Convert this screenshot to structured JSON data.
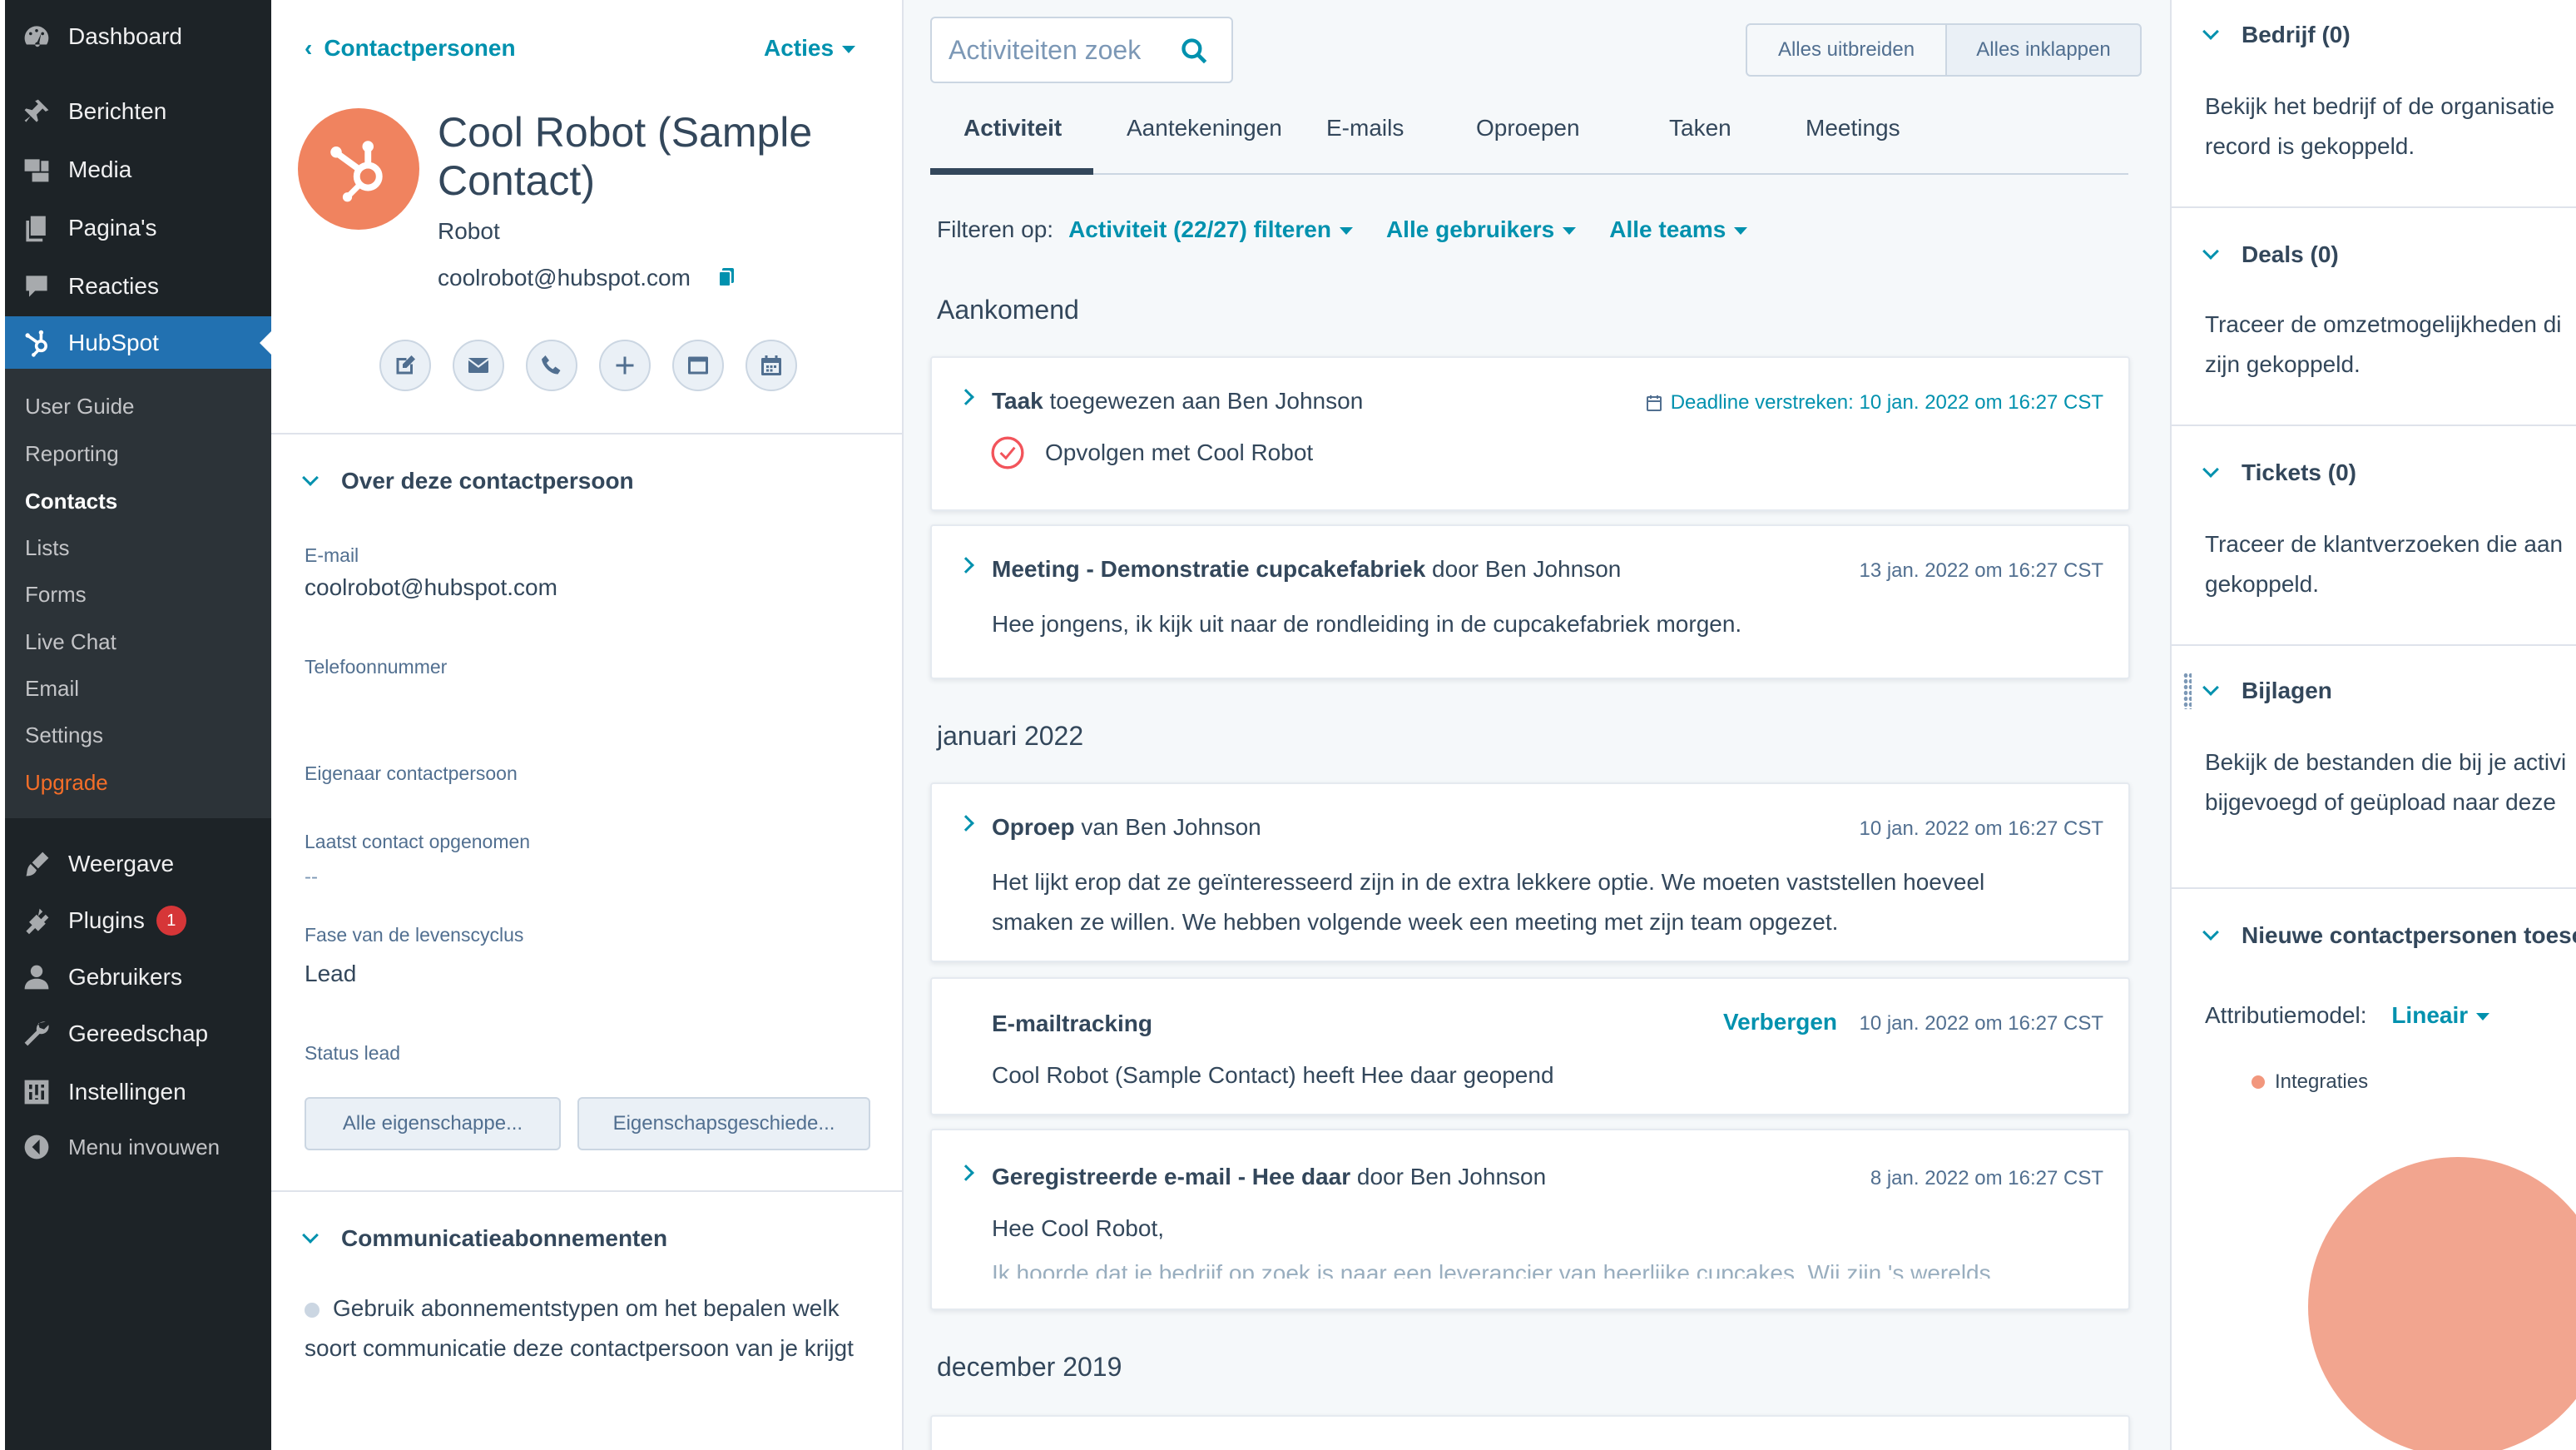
{
  "wp_menu": {
    "top": [
      {
        "label": "Dashboard",
        "icon": "dashboard-icon"
      },
      {
        "label": "Berichten",
        "icon": "pin-icon"
      },
      {
        "label": "Media",
        "icon": "media-icon"
      },
      {
        "label": "Pagina's",
        "icon": "pages-icon"
      },
      {
        "label": "Reacties",
        "icon": "comments-icon"
      },
      {
        "label": "HubSpot",
        "icon": "hubspot-icon"
      }
    ],
    "submenu": [
      "User Guide",
      "Reporting",
      "Contacts",
      "Lists",
      "Forms",
      "Live Chat",
      "Email",
      "Settings",
      "Upgrade"
    ],
    "bottom": [
      {
        "label": "Weergave",
        "icon": "brush-icon"
      },
      {
        "label": "Plugins",
        "icon": "plugin-icon",
        "badge": "1"
      },
      {
        "label": "Gebruikers",
        "icon": "users-icon"
      },
      {
        "label": "Gereedschap",
        "icon": "wrench-icon"
      },
      {
        "label": "Instellingen",
        "icon": "settings-icon"
      },
      {
        "label": "Menu invouwen",
        "icon": "collapse-icon"
      }
    ]
  },
  "contact": {
    "back_label": "Contactpersonen",
    "actions_label": "Acties",
    "name": "Cool Robot (Sample Contact)",
    "role": "Robot",
    "email": "coolrobot@hubspot.com",
    "about_title": "Over deze contactpersoon",
    "properties": [
      {
        "label": "E-mail",
        "value": "coolrobot@hubspot.com"
      },
      {
        "label": "Telefoonnummer",
        "value": ""
      },
      {
        "label": "Eigenaar contactpersoon",
        "value": ""
      },
      {
        "label": "Laatst contact opgenomen",
        "value": "--"
      },
      {
        "label": "Fase van de levenscyclus",
        "value": "Lead"
      },
      {
        "label": "Status lead",
        "value": ""
      }
    ],
    "all_props_button": "Alle eigenschappe...",
    "history_button": "Eigenschapsgeschiede...",
    "comm_title": "Communicatieabonnementen",
    "comm_text": "Gebruik abonnementstypen om het bepalen welk soort communicatie deze contactpersoon van je krijgt"
  },
  "timeline": {
    "search_placeholder": "Activiteiten zoek",
    "expand_all": "Alles uitbreiden",
    "collapse_all": "Alles inklappen",
    "tabs": [
      "Activiteit",
      "Aantekeningen",
      "E-mails",
      "Oproepen",
      "Taken",
      "Meetings"
    ],
    "filter_label": "Filteren op:",
    "filters": [
      "Activiteit (22/27) filteren",
      "Alle gebruikers",
      "Alle teams"
    ],
    "upcoming_header": "Aankomend",
    "task": {
      "type": "Taak",
      "rest": " toegewezen aan Ben Johnson",
      "deadline": "Deadline verstreken: 10 jan. 2022 om 16:27 CST",
      "subject": "Opvolgen met Cool Robot"
    },
    "meeting": {
      "type": "Meeting - Demonstratie cupcakefabriek",
      "rest": " door Ben Johnson",
      "timestamp": "13 jan. 2022 om 16:27 CST",
      "body": "Hee jongens, ik kijk uit naar de rondleiding in de cupcakefabriek morgen."
    },
    "month_header": "januari 2022",
    "call": {
      "type": "Oproep",
      "rest": " van Ben Johnson",
      "timestamp": "10 jan. 2022 om 16:27 CST",
      "body": "Het lijkt erop dat ze geïnteresseerd zijn in de extra lekkere optie. We moeten vaststellen hoeveel smaken ze willen. We hebben volgende week een meeting met zijn team opgezet."
    },
    "tracking": {
      "title": "E-mailtracking",
      "hide_label": "Verbergen",
      "timestamp": "10 jan. 2022 om 16:27 CST",
      "body": "Cool Robot (Sample Contact) heeft Hee daar geopend"
    },
    "logged_email": {
      "type": "Geregistreerde e-mail - Hee daar",
      "rest": " door Ben Johnson",
      "timestamp": "8 jan. 2022 om 16:27 CST",
      "line1": "Hee Cool Robot,",
      "line2": "Ik hoorde dat je bedrijf op zoek is naar een leverancier van heerlijke cupcakes. Wij zijn 's werelds"
    },
    "month_header_2": "december 2019"
  },
  "sidebar_right": {
    "company_title": "Bedrijf (0)",
    "company_text_1": "Bekijk het bedrijf of de organisatie",
    "company_text_2": "record is gekoppeld.",
    "deals_title": "Deals (0)",
    "deals_text_1": "Traceer de omzetmogelijkheden di",
    "deals_text_2": "zijn gekoppeld.",
    "tickets_title": "Tickets (0)",
    "tickets_text_1": "Traceer de klantverzoeken die aan",
    "tickets_text_2": "gekoppeld.",
    "attachments_title": "Bijlagen",
    "attachments_text_1": "Bekijk de bestanden die bij je activi",
    "attachments_text_2": "bijgevoegd of geüpload naar deze",
    "new_contacts_title": "Nieuwe contactpersonen toesc",
    "attribution_label": "Attributiemodel:",
    "attribution_value": "Lineair",
    "legend_item": "Integraties"
  },
  "colors": {
    "accent": "#0091ae",
    "wp_active": "#2271b1",
    "avatar": "#f0835f",
    "pie": "#f2a58f",
    "badge": "#d63638"
  }
}
